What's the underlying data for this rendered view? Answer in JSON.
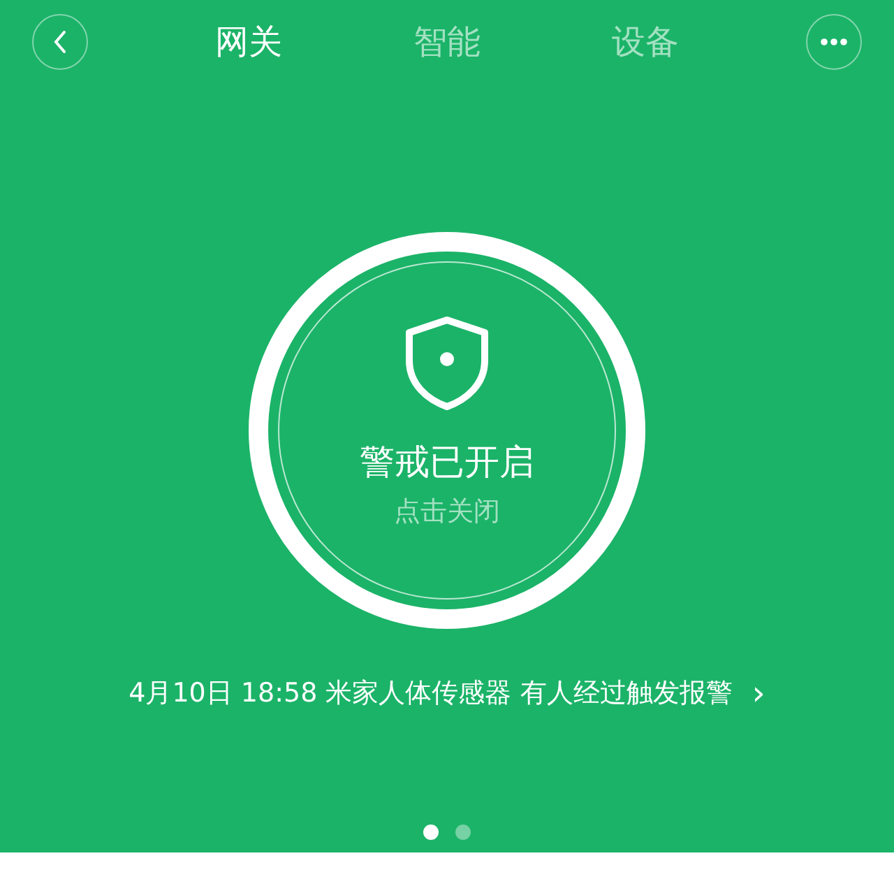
{
  "tabs": [
    {
      "label": "网关",
      "selected": true
    },
    {
      "label": "智能",
      "selected": false
    },
    {
      "label": "设备",
      "selected": false
    }
  ],
  "alarm": {
    "title": "警戒已开启",
    "action": "点击关闭"
  },
  "event": {
    "text": "4月10日 18:58 米家人体传感器 有人经过触发报警",
    "arrow": "›"
  },
  "pages": [
    {
      "selected": true
    },
    {
      "selected": false
    }
  ]
}
